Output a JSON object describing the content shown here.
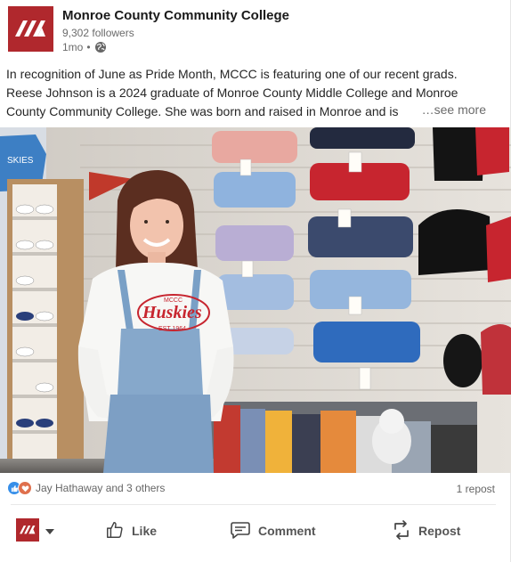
{
  "post": {
    "org_name": "Monroe County Community College",
    "followers": "9,302 followers",
    "time": "1mo",
    "separator": "•",
    "text_lines": [
      "In recognition of June as Pride Month, MCCC is featuring one of our recent grads.",
      "Reese Johnson is a 2024 graduate of Monroe County Middle College and Monroe",
      "County Community College. She was born and raised in Monroe and is"
    ],
    "see_more": "…see more"
  },
  "photo": {
    "sweatshirt_text": "Huskies",
    "sweatshirt_small": "MCCC",
    "sweatshirt_est": "EST 1964"
  },
  "social": {
    "reactors": "Jay Hathaway and 3 others",
    "reposts": "1 repost"
  },
  "actions": {
    "like": "Like",
    "comment": "Comment",
    "repost": "Repost"
  },
  "colors": {
    "brand": "#b0282d",
    "like_blue": "#378fe9",
    "love_orange": "#df704d"
  },
  "icons": [
    "mccc-logo-icon",
    "globe-icon",
    "like-icon",
    "comment-icon",
    "repost-icon",
    "chevron-down-icon"
  ]
}
